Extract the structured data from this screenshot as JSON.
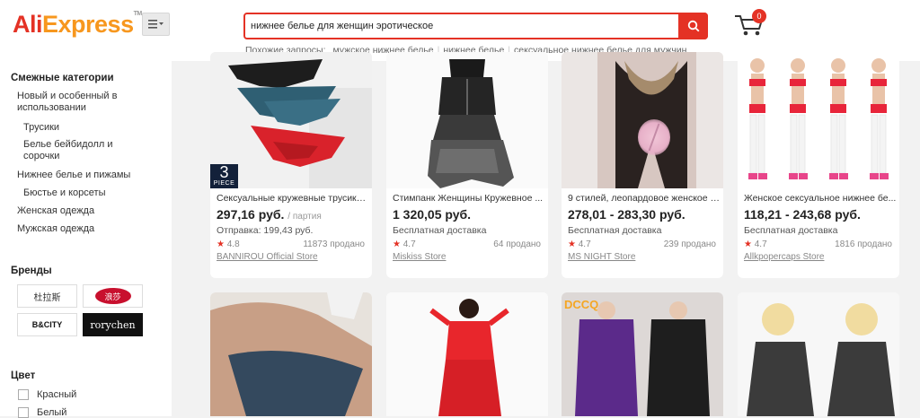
{
  "header": {
    "logo_main": "Ali",
    "logo_accent": "Express",
    "logo_tm": "TM",
    "search_value": "нижнее белье для женщин эротическое",
    "related_label": "Похожие запросы:",
    "related": [
      "мужское нижнее белье",
      "нижнее белье",
      "сексуальное нижнее белье для мужчин"
    ],
    "cart_count": "0"
  },
  "sidebar": {
    "categories_title": "Смежные категории",
    "categories": [
      {
        "label": "Новый и особенный в использовании",
        "level": 1
      },
      {
        "label": "Трусики",
        "level": 2
      },
      {
        "label": "Белье бейбидолл и сорочки",
        "level": 2
      },
      {
        "label": "Нижнее белье и пижамы",
        "level": 1
      },
      {
        "label": "Бюстье и корсеты",
        "level": 2
      },
      {
        "label": "Женская одежда",
        "level": 1
      },
      {
        "label": "Мужская одежда",
        "level": 1
      }
    ],
    "brands_title": "Бренды",
    "brands": [
      "杜拉斯",
      "浪莎",
      "B&CITY",
      "rorychen"
    ],
    "color_title": "Цвет",
    "colors": [
      "Красный",
      "Белый"
    ]
  },
  "products": [
    {
      "title": "Сексуальные кружевные трусики...",
      "price": "297,16 руб.",
      "unit": "/ партия",
      "shipping": "Отправка: 199,43 руб.",
      "rating": "4.8",
      "sold": "11873 продано",
      "store": "BANNIROU Official Store",
      "badge_num": "3",
      "badge_text": "PIECE"
    },
    {
      "title": "Стимпанк Женщины Кружевное ...",
      "price": "1 320,05 руб.",
      "unit": "",
      "shipping": "Бесплатная доставка",
      "rating": "4.7",
      "sold": "64 продано",
      "store": "Miskiss Store"
    },
    {
      "title": "9 стилей, леопардовое женское с...",
      "price": "278,01 - 283,30 руб.",
      "unit": "",
      "shipping": "Бесплатная доставка",
      "rating": "4.7",
      "sold": "239 продано",
      "store": "MS NIGHT Store"
    },
    {
      "title": "Женское сексуальное нижнее бе...",
      "price": "118,21 - 243,68 руб.",
      "unit": "",
      "shipping": "Бесплатная доставка",
      "rating": "4.7",
      "sold": "1816 продано",
      "store": "Allkpopercaps Store"
    }
  ],
  "second_row": {
    "brand_overlay": "DCCQ"
  },
  "icons": {
    "menu": "menu-icon",
    "search": "search-icon",
    "cart": "cart-icon",
    "star": "star-icon"
  },
  "colors": {
    "accent": "#e43225",
    "logo_accent": "#f7971e"
  }
}
